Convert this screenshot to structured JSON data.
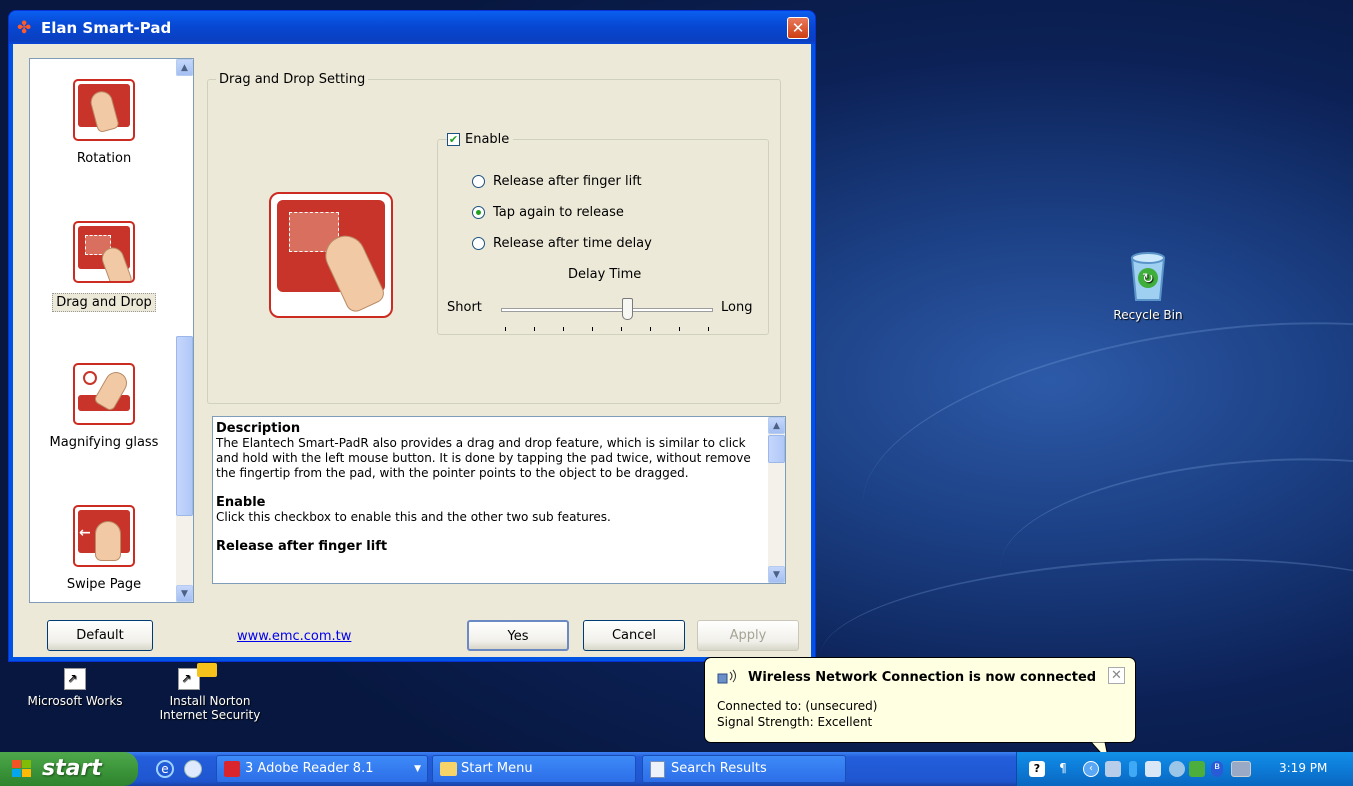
{
  "window": {
    "title": "Elan Smart-Pad",
    "close_label": "✕"
  },
  "sidebar": {
    "items": [
      {
        "label": "Rotation"
      },
      {
        "label": "Drag and Drop"
      },
      {
        "label": "Magnifying glass"
      },
      {
        "label": "Swipe Page"
      }
    ]
  },
  "settings": {
    "group_title": "Drag and Drop Setting",
    "enable_label": "Enable",
    "enable_checked": true,
    "options": [
      {
        "label": "Release after finger lift",
        "selected": false
      },
      {
        "label": "Tap again to release",
        "selected": true
      },
      {
        "label": "Release after time delay",
        "selected": false
      }
    ],
    "delay": {
      "title": "Delay Time",
      "min_label": "Short",
      "max_label": "Long",
      "level": 0.6
    }
  },
  "description": {
    "heading1": "Description",
    "text1": "The Elantech Smart-PadR also provides a drag and drop feature, which is similar to click and hold with the left mouse button. It is done by tapping the pad twice, without remove the fingertip from the pad, with the pointer points to the object to be dragged.",
    "heading2": "Enable",
    "text2": "Click this checkbox to enable this and the other two sub features.",
    "heading3": "Release after finger lift"
  },
  "buttons": {
    "default": "Default",
    "link": "www.emc.com.tw",
    "yes": "Yes",
    "cancel": "Cancel",
    "apply": "Apply"
  },
  "desktop": {
    "icons": [
      {
        "label": "Recycle Bin"
      },
      {
        "label_line1": "Microsoft Works"
      },
      {
        "label_line1": "Install Norton",
        "label_line2": "Internet Security"
      }
    ]
  },
  "balloon": {
    "title": "Wireless Network Connection is now connected",
    "line1": "Connected to: (unsecured)",
    "line2": "Signal Strength: Excellent",
    "close": "✕"
  },
  "taskbar": {
    "start_label": "start",
    "items": [
      {
        "label": "3 Adobe Reader 8.1"
      },
      {
        "label": "Start Menu"
      },
      {
        "label": "Search Results"
      }
    ],
    "clock": "3:19 PM"
  },
  "colors": {
    "accent_red": "#c8342a",
    "xp_blue": "#0054e3",
    "taskbar_green": "#3c963b"
  }
}
